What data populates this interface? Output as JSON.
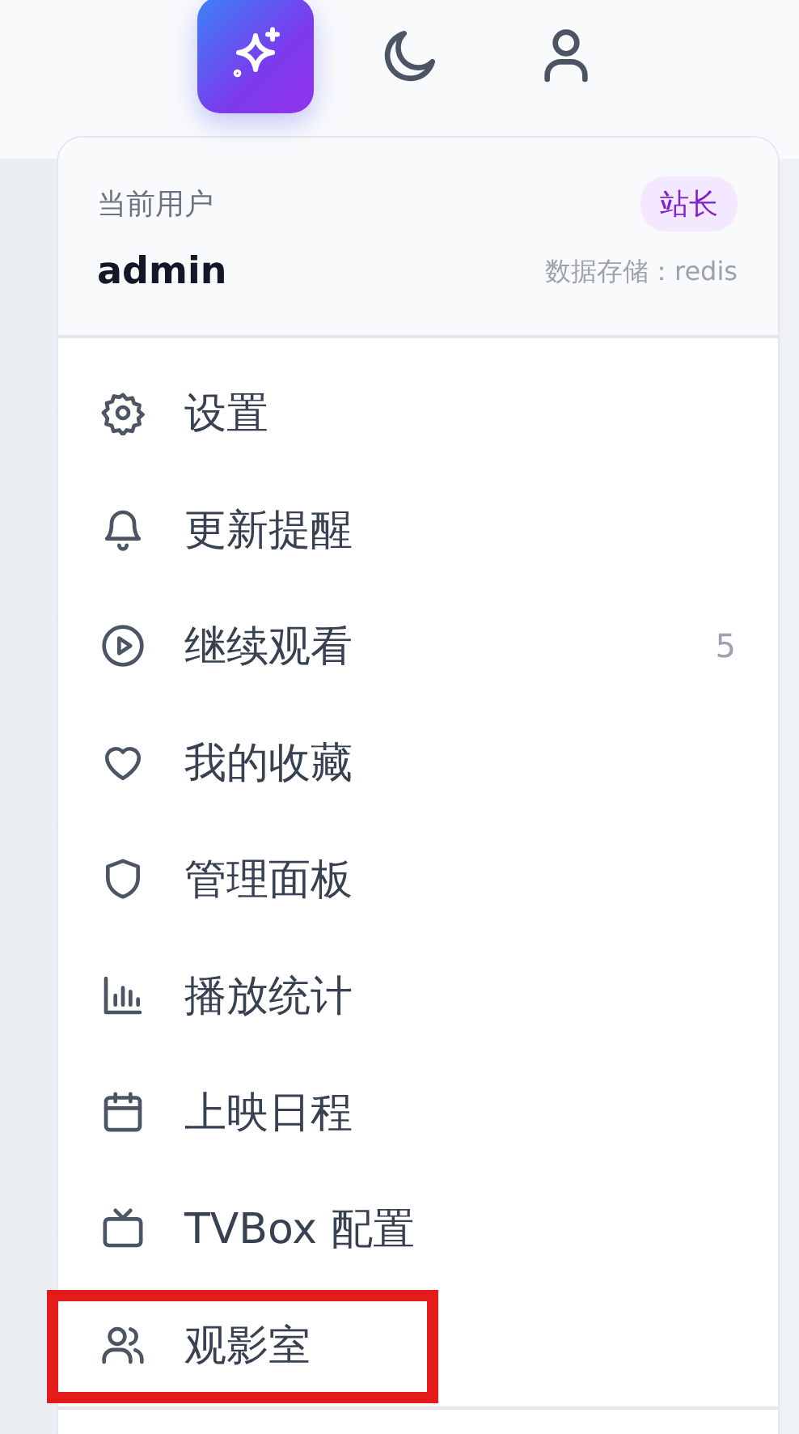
{
  "toolbar": [
    {
      "kind": "sparkle",
      "active": true
    },
    {
      "kind": "moon",
      "active": false
    },
    {
      "kind": "user",
      "active": false
    }
  ],
  "user_menu": {
    "label": "当前用户",
    "role": "站长",
    "username": "admin",
    "storage": "数据存储：redis",
    "items": [
      {
        "kind": "gear",
        "label": "设置",
        "highlighted": false
      },
      {
        "kind": "bell",
        "label": "更新提醒",
        "highlighted": false
      },
      {
        "kind": "play",
        "label": "继续观看",
        "count": "5",
        "highlighted": false
      },
      {
        "kind": "heart",
        "label": "我的收藏",
        "highlighted": false
      },
      {
        "kind": "shield",
        "label": "管理面板",
        "highlighted": false
      },
      {
        "kind": "chart",
        "label": "播放统计",
        "highlighted": false
      },
      {
        "kind": "calendar",
        "label": "上映日程",
        "highlighted": false
      },
      {
        "kind": "tv",
        "label": "TVBox 配置",
        "highlighted": false
      },
      {
        "kind": "users",
        "label": "观影室",
        "highlighted": true
      }
    ]
  }
}
